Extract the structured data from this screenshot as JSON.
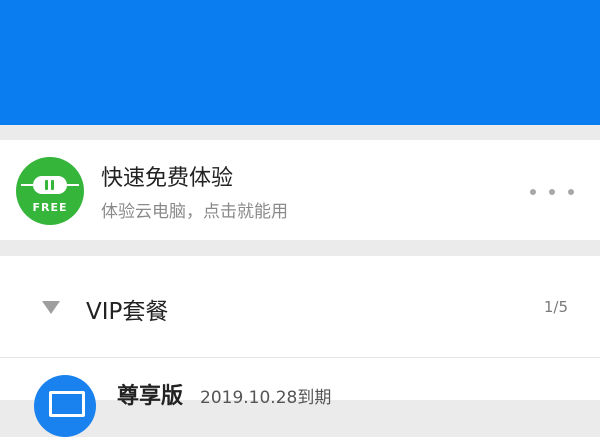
{
  "colors": {
    "header_blue": "#0a7ef0",
    "free_green": "#36b53b",
    "vip_blue": "#1a82ee"
  },
  "free_trial": {
    "title": "快速免费体验",
    "subtitle": "体验云电脑，点击就能用",
    "icon_label": "FREE",
    "icon": "plug-icon"
  },
  "vip_section": {
    "title": "VIP套餐",
    "count": "1/5"
  },
  "vip_item": {
    "name": "尊享版",
    "expiry": "2019.10.28到期",
    "icon": "monitor-icon"
  }
}
